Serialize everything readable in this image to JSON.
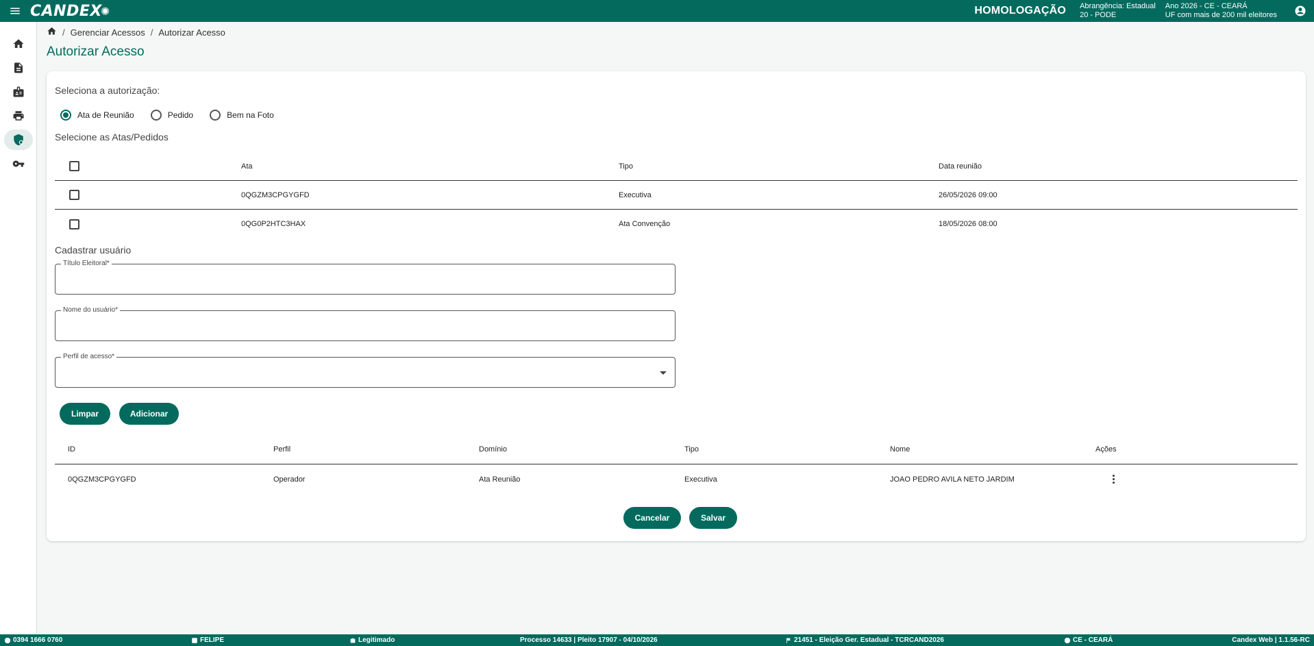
{
  "header": {
    "logo": "CANDEX",
    "environment": "HOMOLOGAÇÃO",
    "abrangencia": "Abrangência: Estadual",
    "partido": "20 - PODE",
    "ano": "Ano 2026 - CE - CEARÁ",
    "uf_info": "UF com mais de 200 mil eleitores"
  },
  "sidebar": {
    "items": [
      {
        "icon": "home-icon"
      },
      {
        "icon": "document-icon"
      },
      {
        "icon": "id-badge-icon"
      },
      {
        "icon": "printer-icon"
      },
      {
        "icon": "shield-lock-icon",
        "active": true
      },
      {
        "icon": "key-icon"
      }
    ]
  },
  "breadcrumb": {
    "items": [
      "Gerenciar Acessos",
      "Autorizar Acesso"
    ]
  },
  "page_title": "Autorizar Acesso",
  "authorization": {
    "label": "Seleciona a autorização:",
    "options": [
      "Ata de Reunião",
      "Pedido",
      "Bem na Foto"
    ],
    "selected": "Ata de Reunião"
  },
  "atas": {
    "label": "Selecione as Atas/Pedidos",
    "columns": [
      "Ata",
      "Tipo",
      "Data reunião"
    ],
    "rows": [
      {
        "ata": "0QGZM3CPGYGFD",
        "tipo": "Executiva",
        "data": "26/05/2026 09:00"
      },
      {
        "ata": "0QG0P2HTC3HAX",
        "tipo": "Ata Convenção",
        "data": "18/05/2026 08:00"
      }
    ]
  },
  "cadastro": {
    "label": "Cadastrar usuário",
    "titulo_label": "Título Eleitoral*",
    "titulo_value": "",
    "nome_label": "Nome do usuário*",
    "nome_value": "",
    "perfil_label": "Perfil de acesso*",
    "perfil_value": ""
  },
  "buttons": {
    "limpar": "Limpar",
    "adicionar": "Adicionar",
    "cancelar": "Cancelar",
    "salvar": "Salvar"
  },
  "users": {
    "columns": [
      "ID",
      "Perfil",
      "Domínio",
      "Tipo",
      "Nome",
      "Ações"
    ],
    "rows": [
      {
        "id": "0QGZM3CPGYGFD",
        "perfil": "Operador",
        "dominio": "Ata Reunião",
        "tipo": "Executiva",
        "nome": "JOAO PEDRO AVILA NETO JARDIM"
      }
    ]
  },
  "footer": {
    "phone": "0394 1666 0760",
    "user": "FELIPE",
    "status": "Legitimado",
    "processo": "Processo 14633 | Pleito 17907 - 04/10/2026",
    "eleicao": "21451 - Eleição Ger. Estadual - TCRCAND2026",
    "uf": "CE - CEARÁ",
    "version": "Candex Web | 1.1.56-RC"
  }
}
